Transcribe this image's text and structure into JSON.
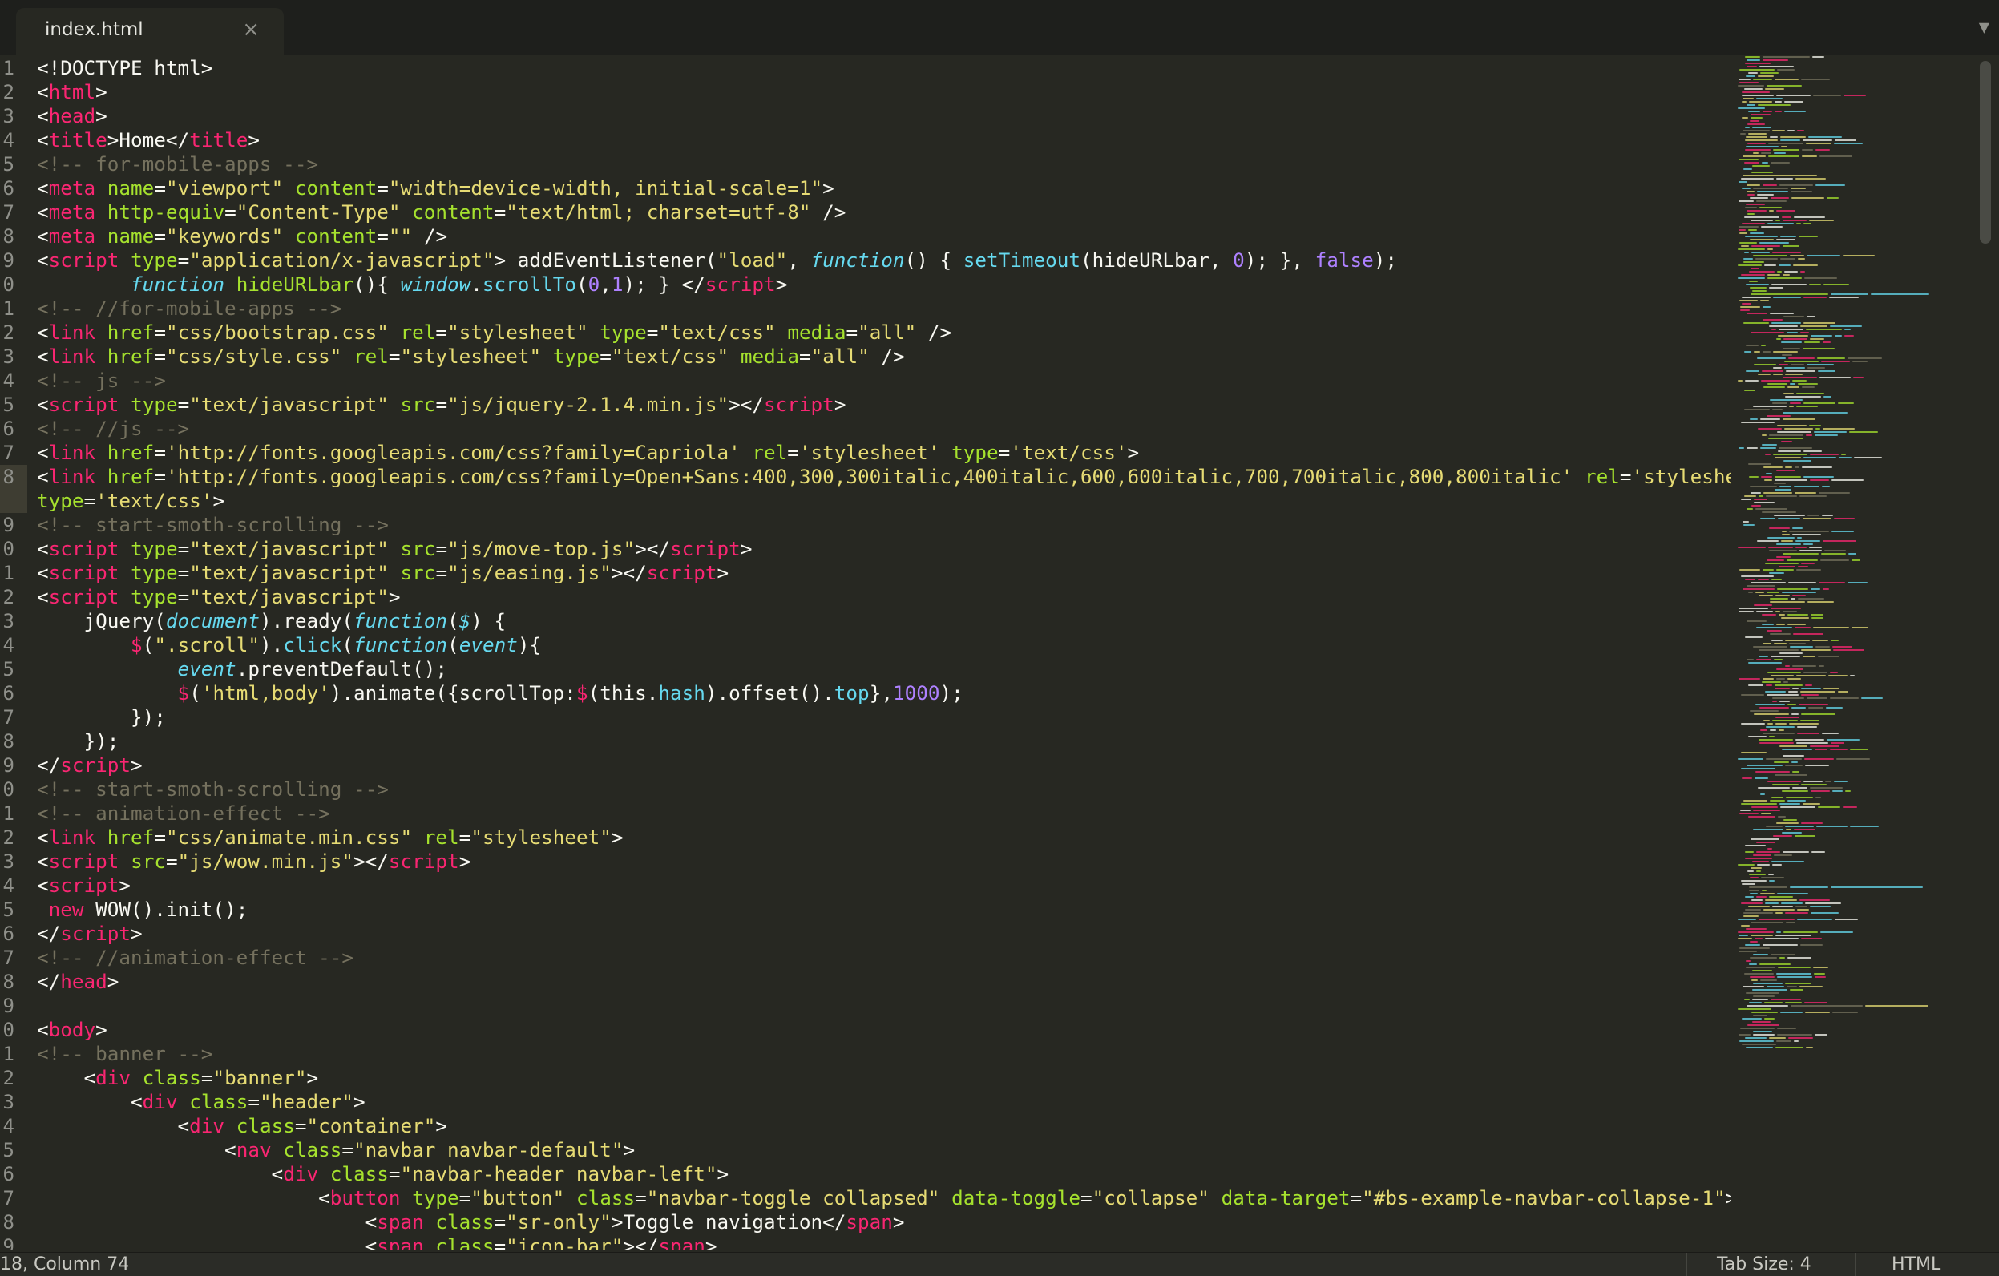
{
  "tab": {
    "title": "index.html",
    "close": "×"
  },
  "tab_menu": "▼",
  "gutter": [
    "1",
    "2",
    "3",
    "4",
    "5",
    "6",
    "7",
    "8",
    "9",
    "0",
    "1",
    "2",
    "3",
    "4",
    "5",
    "6",
    "7",
    "8",
    "",
    "9",
    "0",
    "1",
    "2",
    "3",
    "4",
    "5",
    "6",
    "7",
    "8",
    "9",
    "0",
    "1",
    "2",
    "3",
    "4",
    "5",
    "6",
    "7",
    "8",
    "9",
    "0",
    "1",
    "2",
    "3",
    "4",
    "5",
    "6",
    "7",
    "8",
    "9"
  ],
  "status": {
    "position": "18, Column 74",
    "tab_size": "Tab Size: 4",
    "syntax": "HTML"
  },
  "colors": {
    "background": "#272822",
    "tag": "#f92672",
    "attribute": "#a6e22e",
    "string": "#e6db74",
    "comment": "#75715e",
    "keyword": "#66d9ef",
    "number": "#ae81ff"
  },
  "code": [
    [
      [
        "p",
        "<!DOCTYPE html>"
      ]
    ],
    [
      [
        "p",
        "<"
      ],
      [
        "t",
        "html"
      ],
      [
        "p",
        ">"
      ]
    ],
    [
      [
        "p",
        "<"
      ],
      [
        "t",
        "head"
      ],
      [
        "p",
        ">"
      ]
    ],
    [
      [
        "p",
        "<"
      ],
      [
        "t",
        "title"
      ],
      [
        "p",
        ">Home</"
      ],
      [
        "t",
        "title"
      ],
      [
        "p",
        ">"
      ]
    ],
    [
      [
        "c",
        "<!-- for-mobile-apps -->"
      ]
    ],
    [
      [
        "p",
        "<"
      ],
      [
        "t",
        "meta"
      ],
      [
        "p",
        " "
      ],
      [
        "a",
        "name"
      ],
      [
        "p",
        "="
      ],
      [
        "s",
        "\"viewport\""
      ],
      [
        "p",
        " "
      ],
      [
        "a",
        "content"
      ],
      [
        "p",
        "="
      ],
      [
        "s",
        "\"width=device-width, initial-scale=1\""
      ],
      [
        "p",
        ">"
      ]
    ],
    [
      [
        "p",
        "<"
      ],
      [
        "t",
        "meta"
      ],
      [
        "p",
        " "
      ],
      [
        "a",
        "http-equiv"
      ],
      [
        "p",
        "="
      ],
      [
        "s",
        "\"Content-Type\""
      ],
      [
        "p",
        " "
      ],
      [
        "a",
        "content"
      ],
      [
        "p",
        "="
      ],
      [
        "s",
        "\"text/html; charset=utf-8\""
      ],
      [
        "p",
        " />"
      ]
    ],
    [
      [
        "p",
        "<"
      ],
      [
        "t",
        "meta"
      ],
      [
        "p",
        " "
      ],
      [
        "a",
        "name"
      ],
      [
        "p",
        "="
      ],
      [
        "s",
        "\"keywords\""
      ],
      [
        "p",
        " "
      ],
      [
        "a",
        "content"
      ],
      [
        "p",
        "="
      ],
      [
        "s",
        "\"\""
      ],
      [
        "p",
        " />"
      ]
    ],
    [
      [
        "p",
        "<"
      ],
      [
        "t",
        "script"
      ],
      [
        "p",
        " "
      ],
      [
        "a",
        "type"
      ],
      [
        "p",
        "="
      ],
      [
        "s",
        "\"application/x-javascript\""
      ],
      [
        "p",
        "> addEventListener("
      ],
      [
        "s",
        "\"load\""
      ],
      [
        "p",
        ", "
      ],
      [
        "k",
        "function"
      ],
      [
        "p",
        "() { "
      ],
      [
        "f",
        "setTimeout"
      ],
      [
        "p",
        "(hideURLbar, "
      ],
      [
        "n",
        "0"
      ],
      [
        "p",
        "); }, "
      ],
      [
        "n",
        "false"
      ],
      [
        "p",
        ");"
      ]
    ],
    [
      [
        "p",
        "        "
      ],
      [
        "k",
        "function"
      ],
      [
        "p",
        " "
      ],
      [
        "a",
        "hideURLbar"
      ],
      [
        "p",
        "(){ "
      ],
      [
        "k",
        "window"
      ],
      [
        "p",
        "."
      ],
      [
        "f",
        "scrollTo"
      ],
      [
        "p",
        "("
      ],
      [
        "n",
        "0"
      ],
      [
        "p",
        ","
      ],
      [
        "n",
        "1"
      ],
      [
        "p",
        "); } </"
      ],
      [
        "t",
        "script"
      ],
      [
        "p",
        ">"
      ]
    ],
    [
      [
        "c",
        "<!-- //for-mobile-apps -->"
      ]
    ],
    [
      [
        "p",
        "<"
      ],
      [
        "t",
        "link"
      ],
      [
        "p",
        " "
      ],
      [
        "a",
        "href"
      ],
      [
        "p",
        "="
      ],
      [
        "s",
        "\"css/bootstrap.css\""
      ],
      [
        "p",
        " "
      ],
      [
        "a",
        "rel"
      ],
      [
        "p",
        "="
      ],
      [
        "s",
        "\"stylesheet\""
      ],
      [
        "p",
        " "
      ],
      [
        "a",
        "type"
      ],
      [
        "p",
        "="
      ],
      [
        "s",
        "\"text/css\""
      ],
      [
        "p",
        " "
      ],
      [
        "a",
        "media"
      ],
      [
        "p",
        "="
      ],
      [
        "s",
        "\"all\""
      ],
      [
        "p",
        " />"
      ]
    ],
    [
      [
        "p",
        "<"
      ],
      [
        "t",
        "link"
      ],
      [
        "p",
        " "
      ],
      [
        "a",
        "href"
      ],
      [
        "p",
        "="
      ],
      [
        "s",
        "\"css/style.css\""
      ],
      [
        "p",
        " "
      ],
      [
        "a",
        "rel"
      ],
      [
        "p",
        "="
      ],
      [
        "s",
        "\"stylesheet\""
      ],
      [
        "p",
        " "
      ],
      [
        "a",
        "type"
      ],
      [
        "p",
        "="
      ],
      [
        "s",
        "\"text/css\""
      ],
      [
        "p",
        " "
      ],
      [
        "a",
        "media"
      ],
      [
        "p",
        "="
      ],
      [
        "s",
        "\"all\""
      ],
      [
        "p",
        " />"
      ]
    ],
    [
      [
        "c",
        "<!-- js -->"
      ]
    ],
    [
      [
        "p",
        "<"
      ],
      [
        "t",
        "script"
      ],
      [
        "p",
        " "
      ],
      [
        "a",
        "type"
      ],
      [
        "p",
        "="
      ],
      [
        "s",
        "\"text/javascript\""
      ],
      [
        "p",
        " "
      ],
      [
        "a",
        "src"
      ],
      [
        "p",
        "="
      ],
      [
        "s",
        "\"js/jquery-2.1.4.min.js\""
      ],
      [
        "p",
        "></"
      ],
      [
        "t",
        "script"
      ],
      [
        "p",
        ">"
      ]
    ],
    [
      [
        "c",
        "<!-- //js -->"
      ]
    ],
    [
      [
        "p",
        "<"
      ],
      [
        "t",
        "link"
      ],
      [
        "p",
        " "
      ],
      [
        "a",
        "href"
      ],
      [
        "p",
        "="
      ],
      [
        "s",
        "'http://fonts.googleapis.com/css?family=Capriola'"
      ],
      [
        "p",
        " "
      ],
      [
        "a",
        "rel"
      ],
      [
        "p",
        "="
      ],
      [
        "s",
        "'stylesheet'"
      ],
      [
        "p",
        " "
      ],
      [
        "a",
        "type"
      ],
      [
        "p",
        "="
      ],
      [
        "s",
        "'text/css'"
      ],
      [
        "p",
        ">"
      ]
    ],
    [
      [
        "p",
        "<"
      ],
      [
        "t",
        "link"
      ],
      [
        "p",
        " "
      ],
      [
        "a",
        "href"
      ],
      [
        "p",
        "="
      ],
      [
        "s",
        "'http://fonts.googleapis.com/css?family=Open+Sans:400,300,300italic,400italic,600,600italic,700,700italic,800,800italic'"
      ],
      [
        "p",
        " "
      ],
      [
        "a",
        "rel"
      ],
      [
        "p",
        "="
      ],
      [
        "s",
        "'stylesheet'"
      ]
    ],
    [
      [
        "a",
        "type"
      ],
      [
        "p",
        "="
      ],
      [
        "s",
        "'text/css'"
      ],
      [
        "p",
        ">"
      ]
    ],
    [
      [
        "c",
        "<!-- start-smoth-scrolling -->"
      ]
    ],
    [
      [
        "p",
        "<"
      ],
      [
        "t",
        "script"
      ],
      [
        "p",
        " "
      ],
      [
        "a",
        "type"
      ],
      [
        "p",
        "="
      ],
      [
        "s",
        "\"text/javascript\""
      ],
      [
        "p",
        " "
      ],
      [
        "a",
        "src"
      ],
      [
        "p",
        "="
      ],
      [
        "s",
        "\"js/move-top.js\""
      ],
      [
        "p",
        "></"
      ],
      [
        "t",
        "script"
      ],
      [
        "p",
        ">"
      ]
    ],
    [
      [
        "p",
        "<"
      ],
      [
        "t",
        "script"
      ],
      [
        "p",
        " "
      ],
      [
        "a",
        "type"
      ],
      [
        "p",
        "="
      ],
      [
        "s",
        "\"text/javascript\""
      ],
      [
        "p",
        " "
      ],
      [
        "a",
        "src"
      ],
      [
        "p",
        "="
      ],
      [
        "s",
        "\"js/easing.js\""
      ],
      [
        "p",
        "></"
      ],
      [
        "t",
        "script"
      ],
      [
        "p",
        ">"
      ]
    ],
    [
      [
        "p",
        "<"
      ],
      [
        "t",
        "script"
      ],
      [
        "p",
        " "
      ],
      [
        "a",
        "type"
      ],
      [
        "p",
        "="
      ],
      [
        "s",
        "\"text/javascript\""
      ],
      [
        "p",
        ">"
      ]
    ],
    [
      [
        "p",
        "    jQuery("
      ],
      [
        "k",
        "document"
      ],
      [
        "p",
        ").ready("
      ],
      [
        "k",
        "function"
      ],
      [
        "p",
        "("
      ],
      [
        "k",
        "$"
      ],
      [
        "p",
        ") {"
      ]
    ],
    [
      [
        "p",
        "        "
      ],
      [
        "t",
        "$"
      ],
      [
        "p",
        "("
      ],
      [
        "s",
        "\".scroll\""
      ],
      [
        "p",
        ")."
      ],
      [
        "f",
        "click"
      ],
      [
        "p",
        "("
      ],
      [
        "k",
        "function"
      ],
      [
        "p",
        "("
      ],
      [
        "k",
        "event"
      ],
      [
        "p",
        "){"
      ]
    ],
    [
      [
        "p",
        "            "
      ],
      [
        "k",
        "event"
      ],
      [
        "p",
        ".preventDefault();"
      ]
    ],
    [
      [
        "p",
        "            "
      ],
      [
        "t",
        "$"
      ],
      [
        "p",
        "("
      ],
      [
        "s",
        "'html,body'"
      ],
      [
        "p",
        ").animate({scrollTop:"
      ],
      [
        "t",
        "$"
      ],
      [
        "p",
        "(this."
      ],
      [
        "f",
        "hash"
      ],
      [
        "p",
        ").offset()."
      ],
      [
        "f",
        "top"
      ],
      [
        "p",
        "},"
      ],
      [
        "n",
        "1000"
      ],
      [
        "p",
        ");"
      ]
    ],
    [
      [
        "p",
        "        });"
      ]
    ],
    [
      [
        "p",
        "    });"
      ]
    ],
    [
      [
        "p",
        "</"
      ],
      [
        "t",
        "script"
      ],
      [
        "p",
        ">"
      ]
    ],
    [
      [
        "c",
        "<!-- start-smoth-scrolling -->"
      ]
    ],
    [
      [
        "c",
        "<!-- animation-effect -->"
      ]
    ],
    [
      [
        "p",
        "<"
      ],
      [
        "t",
        "link"
      ],
      [
        "p",
        " "
      ],
      [
        "a",
        "href"
      ],
      [
        "p",
        "="
      ],
      [
        "s",
        "\"css/animate.min.css\""
      ],
      [
        "p",
        " "
      ],
      [
        "a",
        "rel"
      ],
      [
        "p",
        "="
      ],
      [
        "s",
        "\"stylesheet\""
      ],
      [
        "p",
        ">"
      ]
    ],
    [
      [
        "p",
        "<"
      ],
      [
        "t",
        "script"
      ],
      [
        "p",
        " "
      ],
      [
        "a",
        "src"
      ],
      [
        "p",
        "="
      ],
      [
        "s",
        "\"js/wow.min.js\""
      ],
      [
        "p",
        "></"
      ],
      [
        "t",
        "script"
      ],
      [
        "p",
        ">"
      ]
    ],
    [
      [
        "p",
        "<"
      ],
      [
        "t",
        "script"
      ],
      [
        "p",
        ">"
      ]
    ],
    [
      [
        "p",
        " "
      ],
      [
        "t",
        "new"
      ],
      [
        "p",
        " WOW().init();"
      ]
    ],
    [
      [
        "p",
        "</"
      ],
      [
        "t",
        "script"
      ],
      [
        "p",
        ">"
      ]
    ],
    [
      [
        "c",
        "<!-- //animation-effect -->"
      ]
    ],
    [
      [
        "p",
        "</"
      ],
      [
        "t",
        "head"
      ],
      [
        "p",
        ">"
      ]
    ],
    [
      [
        "p",
        ""
      ]
    ],
    [
      [
        "p",
        "<"
      ],
      [
        "t",
        "body"
      ],
      [
        "p",
        ">"
      ]
    ],
    [
      [
        "c",
        "<!-- banner -->"
      ]
    ],
    [
      [
        "p",
        "    <"
      ],
      [
        "t",
        "div"
      ],
      [
        "p",
        " "
      ],
      [
        "a",
        "class"
      ],
      [
        "p",
        "="
      ],
      [
        "s",
        "\"banner\""
      ],
      [
        "p",
        ">"
      ]
    ],
    [
      [
        "p",
        "        <"
      ],
      [
        "t",
        "div"
      ],
      [
        "p",
        " "
      ],
      [
        "a",
        "class"
      ],
      [
        "p",
        "="
      ],
      [
        "s",
        "\"header\""
      ],
      [
        "p",
        ">"
      ]
    ],
    [
      [
        "p",
        "            <"
      ],
      [
        "t",
        "div"
      ],
      [
        "p",
        " "
      ],
      [
        "a",
        "class"
      ],
      [
        "p",
        "="
      ],
      [
        "s",
        "\"container\""
      ],
      [
        "p",
        ">"
      ]
    ],
    [
      [
        "p",
        "                <"
      ],
      [
        "t",
        "nav"
      ],
      [
        "p",
        " "
      ],
      [
        "a",
        "class"
      ],
      [
        "p",
        "="
      ],
      [
        "s",
        "\"navbar navbar-default\""
      ],
      [
        "p",
        ">"
      ]
    ],
    [
      [
        "p",
        "                    <"
      ],
      [
        "t",
        "div"
      ],
      [
        "p",
        " "
      ],
      [
        "a",
        "class"
      ],
      [
        "p",
        "="
      ],
      [
        "s",
        "\"navbar-header navbar-left\""
      ],
      [
        "p",
        ">"
      ]
    ],
    [
      [
        "p",
        "                        <"
      ],
      [
        "t",
        "button"
      ],
      [
        "p",
        " "
      ],
      [
        "a",
        "type"
      ],
      [
        "p",
        "="
      ],
      [
        "s",
        "\"button\""
      ],
      [
        "p",
        " "
      ],
      [
        "a",
        "class"
      ],
      [
        "p",
        "="
      ],
      [
        "s",
        "\"navbar-toggle collapsed\""
      ],
      [
        "p",
        " "
      ],
      [
        "a",
        "data-toggle"
      ],
      [
        "p",
        "="
      ],
      [
        "s",
        "\"collapse\""
      ],
      [
        "p",
        " "
      ],
      [
        "a",
        "data-target"
      ],
      [
        "p",
        "="
      ],
      [
        "s",
        "\"#bs-example-navbar-collapse-1\""
      ],
      [
        "p",
        ">"
      ]
    ],
    [
      [
        "p",
        "                            <"
      ],
      [
        "t",
        "span"
      ],
      [
        "p",
        " "
      ],
      [
        "a",
        "class"
      ],
      [
        "p",
        "="
      ],
      [
        "s",
        "\"sr-only\""
      ],
      [
        "p",
        ">Toggle navigation</"
      ],
      [
        "t",
        "span"
      ],
      [
        "p",
        ">"
      ]
    ],
    [
      [
        "p",
        "                            <"
      ],
      [
        "t",
        "span"
      ],
      [
        "p",
        " "
      ],
      [
        "a",
        "class"
      ],
      [
        "p",
        "="
      ],
      [
        "s",
        "\"icon-bar\""
      ],
      [
        "p",
        "></"
      ],
      [
        "t",
        "span"
      ],
      [
        "p",
        ">"
      ]
    ]
  ]
}
